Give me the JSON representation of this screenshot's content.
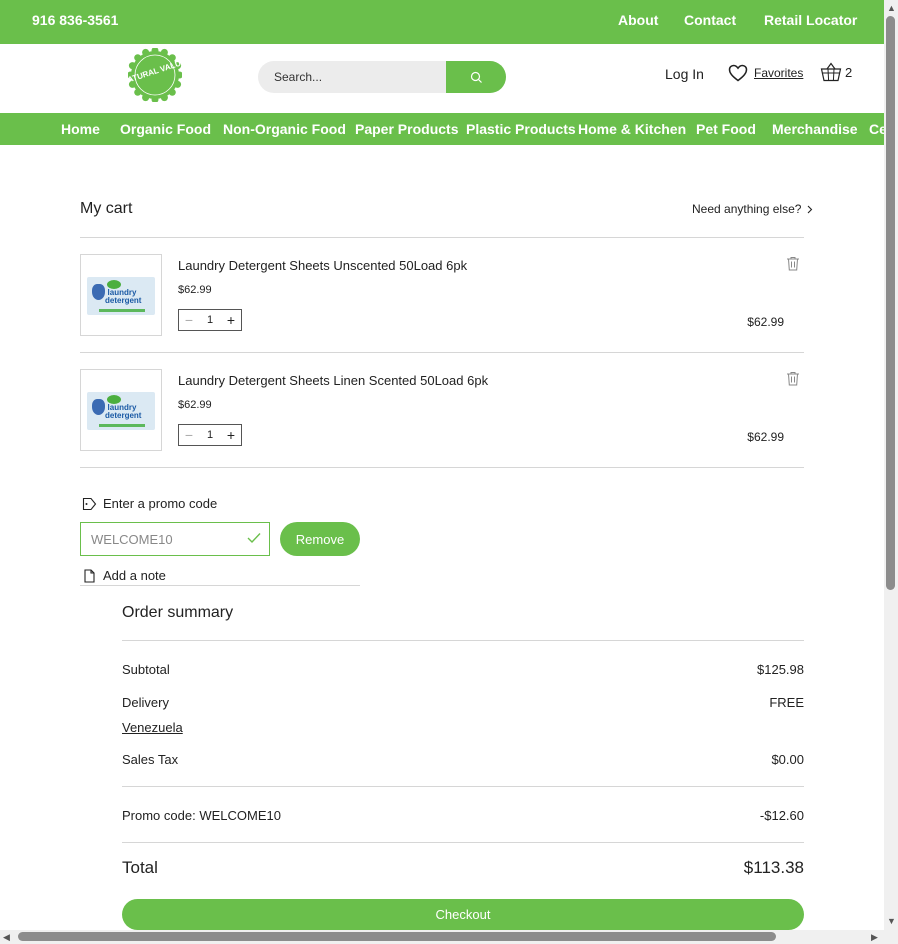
{
  "topbar": {
    "phone": "916 836-3561",
    "links": [
      "About",
      "Contact",
      "Retail Locator"
    ]
  },
  "header": {
    "logo_text": "NATURAL VALUE",
    "search_placeholder": "Search...",
    "login": "Log In",
    "favorites": "Favorites",
    "cart_count": "2"
  },
  "nav": {
    "items": [
      "Home",
      "Organic Food",
      "Non-Organic Food",
      "Paper Products",
      "Plastic Products",
      "Home & Kitchen",
      "Pet Food",
      "Merchandise",
      "Ce"
    ]
  },
  "cart": {
    "title": "My cart",
    "need_more": "Need anything else?",
    "items": [
      {
        "name": "Laundry Detergent Sheets Unscented 50Load 6pk",
        "price": "$62.99",
        "qty": "1",
        "total": "$62.99",
        "image_label": "laundry detergent"
      },
      {
        "name": "Laundry Detergent Sheets Linen Scented 50Load 6pk",
        "price": "$62.99",
        "qty": "1",
        "total": "$62.99",
        "image_label": "laundry detergent"
      }
    ],
    "promo_label": "Enter a promo code",
    "promo_value": "WELCOME10",
    "remove_label": "Remove",
    "note_label": "Add a note"
  },
  "summary": {
    "title": "Order summary",
    "subtotal_label": "Subtotal",
    "subtotal": "$125.98",
    "delivery_label": "Delivery",
    "delivery": "FREE",
    "country": "Venezuela",
    "tax_label": "Sales Tax",
    "tax": "$0.00",
    "promo_label": "Promo code: WELCOME10",
    "promo": "-$12.60",
    "total_label": "Total",
    "total": "$113.38",
    "checkout_label": "Checkout"
  },
  "colors": {
    "brand_green": "#6abf4b"
  }
}
